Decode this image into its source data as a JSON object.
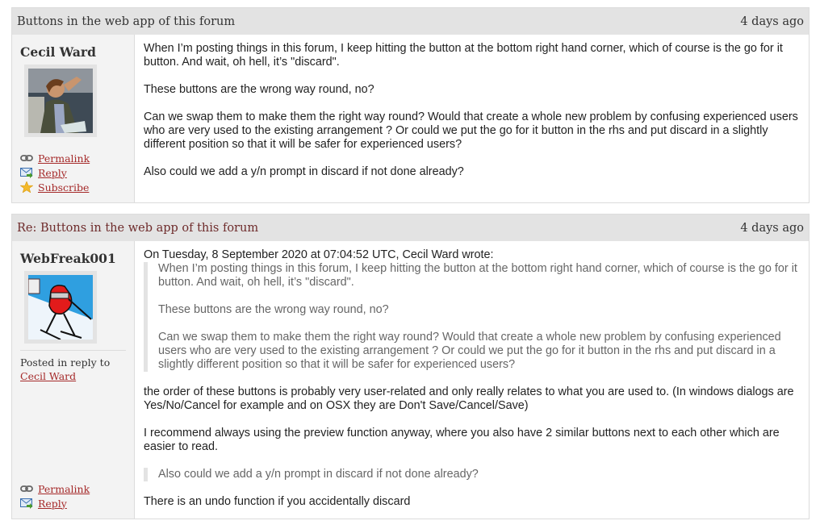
{
  "posts": [
    {
      "title": "Buttons in the web app of this forum",
      "time": "4 days ago",
      "author": "Cecil Ward",
      "paragraphs": [
        "When I’m posting things in this forum, I keep hitting the button at the bottom right hand corner, which of course is the go for it button. And wait, oh hell, it’s \"discard\".",
        "These buttons are the wrong way round, no?",
        "Can we swap them to make them the right way round? Would that create a whole new problem by confusing experienced users who are very used to the existing arrangement ? Or could we put the go for it button in the rhs and put discard in a slightly different position so that it will be safer for experienced users?",
        "Also could we add a y/n prompt in discard if not done already?"
      ],
      "links": {
        "permalink": "Permalink",
        "reply": "Reply",
        "subscribe": "Subscribe"
      }
    },
    {
      "title": "Re: Buttons in the web app of this forum",
      "time": "4 days ago",
      "author": "WebFreak001",
      "posted_in_reply_to": "Posted in reply to",
      "reply_to_author": "Cecil Ward",
      "quote_intro": "On Tuesday, 8 September 2020 at 07:04:52 UTC, Cecil Ward wrote:",
      "quote": [
        "When I’m posting things in this forum, I keep hitting the button at the bottom right hand corner, which of course is the go for it button. And wait, oh hell, it’s \"discard\".",
        "These buttons are the wrong way round, no?",
        "Can we swap them to make them the right way round? Would that create a whole new problem by confusing experienced users who are very used to the existing arrangement ? Or could we put the go for it button in the rhs and put discard in a slightly different position so that it will be safer for experienced users?"
      ],
      "paragraphs": [
        "the order of these buttons is probably very user-related and only really relates to what you are used to. (In windows dialogs are Yes/No/Cancel for example and on OSX they are Don't Save/Cancel/Save)",
        "I recommend always using the preview function anyway, where you also have 2 similar buttons next to each other which are easier to read."
      ],
      "quote2": "Also could we add a y/n prompt in discard if not done already?",
      "last_paragraph": "There is an undo function if you accidentally discard",
      "links": {
        "permalink": "Permalink",
        "reply": "Reply"
      }
    }
  ]
}
